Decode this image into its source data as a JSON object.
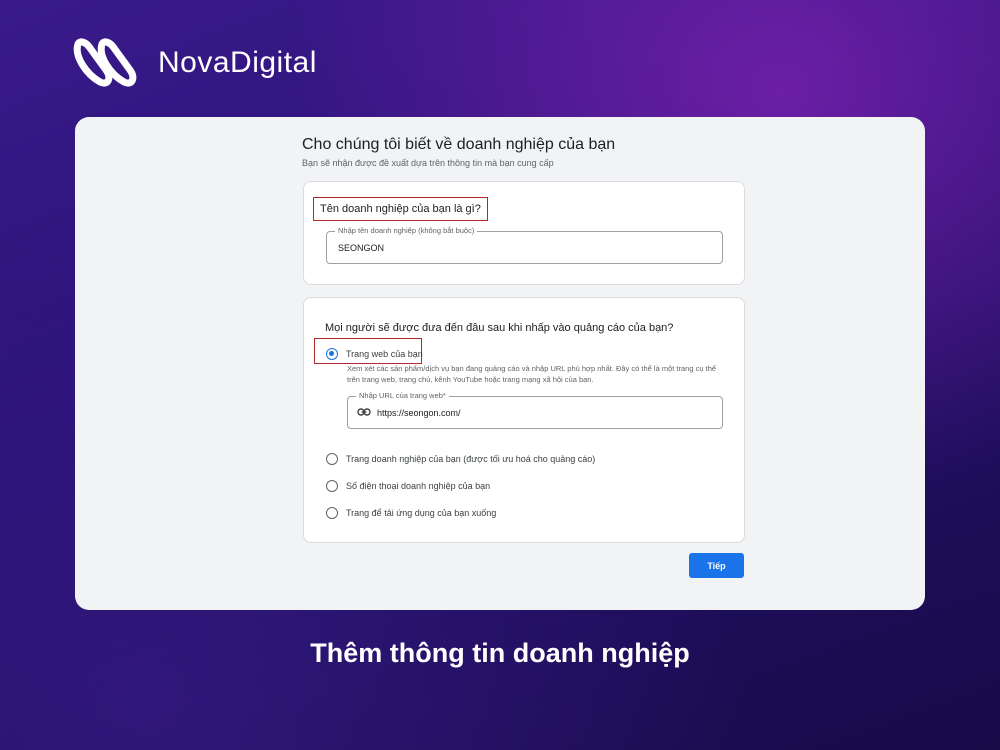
{
  "brand": {
    "name": "NovaDigital",
    "logo_icon": "nova-double-loop-logo"
  },
  "form": {
    "title": "Cho chúng tôi biết về doanh nghiệp của bạn",
    "subtitle": "Bạn sẽ nhận được đề xuất dựa trên thông tin mà bạn cung cấp",
    "business_name": {
      "question": "Tên doanh nghiệp của bạn là gì?",
      "field_label": "Nhập tên doanh nghiệp (không bắt buộc)",
      "value": "SEONGON"
    },
    "destination": {
      "question": "Mọi người sẽ được đưa đến đâu sau khi nhấp vào quảng cáo của bạn?",
      "options": [
        {
          "label": "Trang web của bạn",
          "selected": true
        },
        {
          "label": "Trang doanh nghiệp của bạn (được tối ưu hoá cho quảng cáo)",
          "selected": false
        },
        {
          "label": "Số điện thoại doanh nghiệp của bạn",
          "selected": false
        },
        {
          "label": "Trang để tải ứng dụng của bạn xuống",
          "selected": false
        }
      ],
      "website_description": "Xem xét các sản phẩm/dịch vụ bạn đang quảng cáo và nhập URL phù hợp nhất. Đây có thể là một trang cụ thể trên trang web, trang chủ, kênh YouTube hoặc trang mạng xã hội của bạn.",
      "url_field_label": "Nhập URL của trang web*",
      "url_value": "https://seongon.com/",
      "url_icon": "link-icon"
    },
    "next_button": "Tiếp"
  },
  "caption": "Thêm thông tin doanh nghiệp",
  "colors": {
    "accent": "#1a73e8",
    "highlight_border": "#b3262b"
  }
}
